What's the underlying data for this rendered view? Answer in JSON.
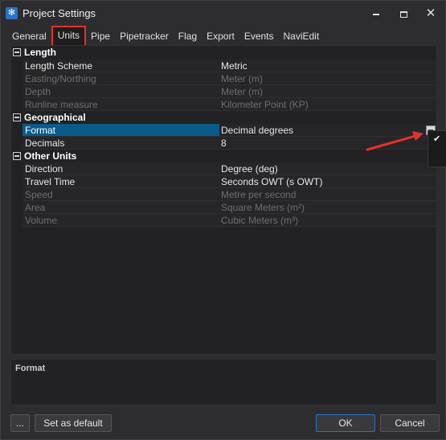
{
  "window": {
    "title": "Project Settings"
  },
  "tabs": [
    {
      "label": "General",
      "active": false
    },
    {
      "label": "Units",
      "active": true
    },
    {
      "label": "Pipe",
      "active": false
    },
    {
      "label": "Pipetracker",
      "active": false
    },
    {
      "label": "Flag",
      "active": false
    },
    {
      "label": "Export",
      "active": false
    },
    {
      "label": "Events",
      "active": false
    },
    {
      "label": "NaviEdit",
      "active": false
    }
  ],
  "grid": {
    "categories": [
      {
        "label": "Length",
        "properties": [
          {
            "name": "Length Scheme",
            "value": "Metric",
            "enabled": true
          },
          {
            "name": "Easting/Northing",
            "value": "Meter (m)",
            "enabled": false
          },
          {
            "name": "Depth",
            "value": "Meter (m)",
            "enabled": false
          },
          {
            "name": "Runline measure",
            "value": "Kilometer Point (KP)",
            "enabled": false
          }
        ]
      },
      {
        "label": "Geographical",
        "properties": [
          {
            "name": "Format",
            "value": "Decimal degrees",
            "enabled": true,
            "selected": true
          },
          {
            "name": "Decimals",
            "value": "8",
            "enabled": true
          }
        ]
      },
      {
        "label": "Other Units",
        "properties": [
          {
            "name": "Direction",
            "value": "Degree (deg)",
            "enabled": true
          },
          {
            "name": "Travel Time",
            "value": "Seconds OWT (s OWT)",
            "enabled": true
          },
          {
            "name": "Speed",
            "value": "Metre per second",
            "enabled": false
          },
          {
            "name": "Area",
            "value": "Square Meters (m²)",
            "enabled": false
          },
          {
            "name": "Volume",
            "value": "Cubic Meters (m³)",
            "enabled": false
          }
        ]
      }
    ]
  },
  "description": {
    "title": "Format"
  },
  "buttons": {
    "more": "...",
    "set_default": "Set as default",
    "ok": "OK",
    "cancel": "Cancel"
  },
  "colors": {
    "background": "#2d2d30",
    "grid_background": "#222224",
    "selection": "#0a5a8a",
    "highlight_border": "#e4322b",
    "annotation_arrow": "#e4322b",
    "accent": "#2a73c5"
  }
}
